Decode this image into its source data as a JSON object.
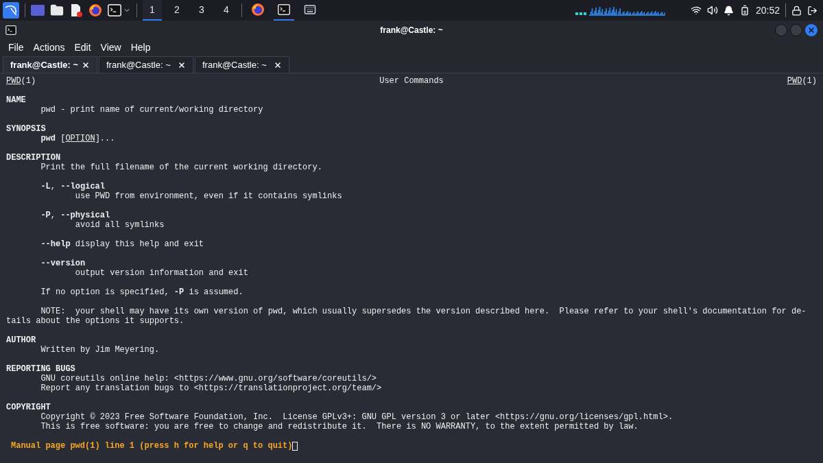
{
  "taskbar": {
    "workspaces": [
      {
        "label": "1",
        "selected": true
      },
      {
        "label": "2",
        "selected": false
      },
      {
        "label": "3",
        "selected": false
      },
      {
        "label": "4",
        "selected": false
      }
    ],
    "running": [
      {
        "kind": "firefox",
        "selected": false
      },
      {
        "kind": "terminal",
        "selected": true
      },
      {
        "kind": "keyboard",
        "selected": false
      }
    ],
    "clock": "20:52"
  },
  "window": {
    "title": "frank@Castle: ~",
    "menu": [
      "File",
      "Actions",
      "Edit",
      "View",
      "Help"
    ],
    "tabs": [
      {
        "label": "frank@Castle: ~",
        "selected": true
      },
      {
        "label": "frank@Castle: ~",
        "selected": false
      },
      {
        "label": "frank@Castle: ~",
        "selected": false
      }
    ]
  },
  "man_page": {
    "header": {
      "left": [
        {
          "text": "PWD",
          "kind": "underline"
        },
        {
          "text": "(1)",
          "kind": "plain"
        }
      ],
      "center": "User Commands",
      "right": [
        {
          "text": "PWD",
          "kind": "underline"
        },
        {
          "text": "(1)",
          "kind": "plain"
        }
      ]
    },
    "sections": [
      {
        "title": "NAME",
        "blocks": [
          [
            {
              "kind": "text",
              "segments": [
                {
                  "text": "pwd - print name of current/working directory",
                  "kind": "plain"
                }
              ]
            }
          ]
        ]
      },
      {
        "title": "SYNOPSIS",
        "blocks": [
          [
            {
              "kind": "text",
              "segments": [
                {
                  "text": "pwd",
                  "kind": "bold"
                },
                {
                  "text": " [",
                  "kind": "plain"
                },
                {
                  "text": "OPTION",
                  "kind": "underline"
                },
                {
                  "text": "]...",
                  "kind": "plain"
                }
              ]
            }
          ]
        ]
      },
      {
        "title": "DESCRIPTION",
        "blocks": [
          [
            {
              "kind": "text",
              "segments": [
                {
                  "text": "Print the full filename of the current working directory.",
                  "kind": "plain"
                }
              ]
            }
          ],
          [
            {
              "kind": "text",
              "segments": [
                {
                  "text": "-L",
                  "kind": "bold"
                },
                {
                  "text": ", ",
                  "kind": "plain"
                },
                {
                  "text": "--logical",
                  "kind": "bold"
                }
              ]
            },
            {
              "kind": "sub",
              "segments": [
                {
                  "text": "use PWD from environment, even if it contains symlinks",
                  "kind": "plain"
                }
              ]
            }
          ],
          [
            {
              "kind": "text",
              "segments": [
                {
                  "text": "-P",
                  "kind": "bold"
                },
                {
                  "text": ", ",
                  "kind": "plain"
                },
                {
                  "text": "--physical",
                  "kind": "bold"
                }
              ]
            },
            {
              "kind": "sub",
              "segments": [
                {
                  "text": "avoid all symlinks",
                  "kind": "plain"
                }
              ]
            }
          ],
          [
            {
              "kind": "text",
              "segments": [
                {
                  "text": "--help",
                  "kind": "bold"
                },
                {
                  "text": " display this help and exit",
                  "kind": "plain"
                }
              ]
            }
          ],
          [
            {
              "kind": "text",
              "segments": [
                {
                  "text": "--version",
                  "kind": "bold"
                }
              ]
            },
            {
              "kind": "sub",
              "segments": [
                {
                  "text": "output version information and exit",
                  "kind": "plain"
                }
              ]
            }
          ],
          [
            {
              "kind": "text",
              "segments": [
                {
                  "text": "If no option is specified, ",
                  "kind": "plain"
                },
                {
                  "text": "-P",
                  "kind": "bold"
                },
                {
                  "text": " is assumed.",
                  "kind": "plain"
                }
              ]
            }
          ],
          [
            {
              "kind": "text",
              "segments": [
                {
                  "text": "NOTE:  your shell may have its own version of pwd, which usually supersedes the version described here.  Please refer to your shell's documentation for de-",
                  "kind": "plain"
                }
              ]
            },
            {
              "kind": "flush",
              "segments": [
                {
                  "text": "tails about the options it supports.",
                  "kind": "plain"
                }
              ]
            }
          ]
        ]
      },
      {
        "title": "AUTHOR",
        "blocks": [
          [
            {
              "kind": "text",
              "segments": [
                {
                  "text": "Written by Jim Meyering.",
                  "kind": "plain"
                }
              ]
            }
          ]
        ]
      },
      {
        "title": "REPORTING BUGS",
        "blocks": [
          [
            {
              "kind": "text",
              "segments": [
                {
                  "text": "GNU coreutils online help: <https://www.gnu.org/software/coreutils/>",
                  "kind": "plain"
                }
              ]
            },
            {
              "kind": "text",
              "segments": [
                {
                  "text": "Report any translation bugs to <https://translationproject.org/team/>",
                  "kind": "plain"
                }
              ]
            }
          ]
        ]
      },
      {
        "title": "COPYRIGHT",
        "blocks": [
          [
            {
              "kind": "text",
              "segments": [
                {
                  "text": "Copyright © 2023 Free Software Foundation, Inc.  License GPLv3+: GNU GPL version 3 or later <https://gnu.org/licenses/gpl.html>.",
                  "kind": "plain"
                }
              ]
            },
            {
              "kind": "text",
              "segments": [
                {
                  "text": "This is free software: you are free to change and redistribute it.  There is NO WARRANTY, to the extent permitted by law.",
                  "kind": "plain"
                }
              ]
            }
          ]
        ]
      }
    ],
    "status": "Manual page pwd(1) line 1 (press h for help or q to quit)"
  }
}
